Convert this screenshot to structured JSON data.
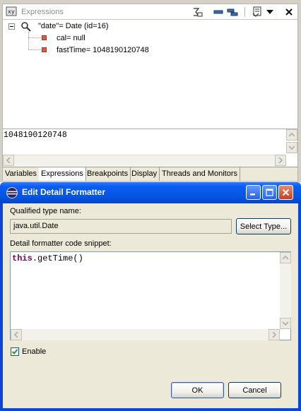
{
  "expressions_view": {
    "title": "Expressions",
    "title_icon": "expressions-view-icon",
    "toolbar_icons": [
      "remove-expression-icon",
      "remove-all-icon",
      "show-type-names-icon",
      "collapse-all-icon",
      "view-menu-icon",
      "view-menu-arrow-icon",
      "close-icon"
    ],
    "tree": [
      {
        "label": "\"date\"= Date  (id=16)",
        "icon": "watch-expression-icon",
        "expanded": true
      },
      {
        "label": "cal= null",
        "icon": "field-icon"
      },
      {
        "label": "fastTime= 1048190120748",
        "icon": "field-icon"
      }
    ],
    "detail_text": "1048190120748",
    "tabs": [
      "Variables",
      "Expressions",
      "Breakpoints",
      "Display",
      "Threads and Monitors"
    ],
    "active_tab": "Expressions"
  },
  "dialog": {
    "title": "Edit Detail Formatter",
    "icon": "eclipse-icon",
    "qualified_type_label": "Qualified type name:",
    "qualified_type_value": "java.util.Date",
    "select_type_label": "Select Type...",
    "snippet_label": "Detail formatter code snippet:",
    "snippet_keyword": "this",
    "snippet_rest": ".getTime()",
    "enable_label": "Enable",
    "enable_checked": true,
    "ok_label": "OK",
    "cancel_label": "Cancel"
  },
  "colors": {
    "titlebar": "#0a5df4",
    "dialog_bg": "#ece9d8",
    "keyword": "#7f0055",
    "field_icon": "#e0574b"
  }
}
